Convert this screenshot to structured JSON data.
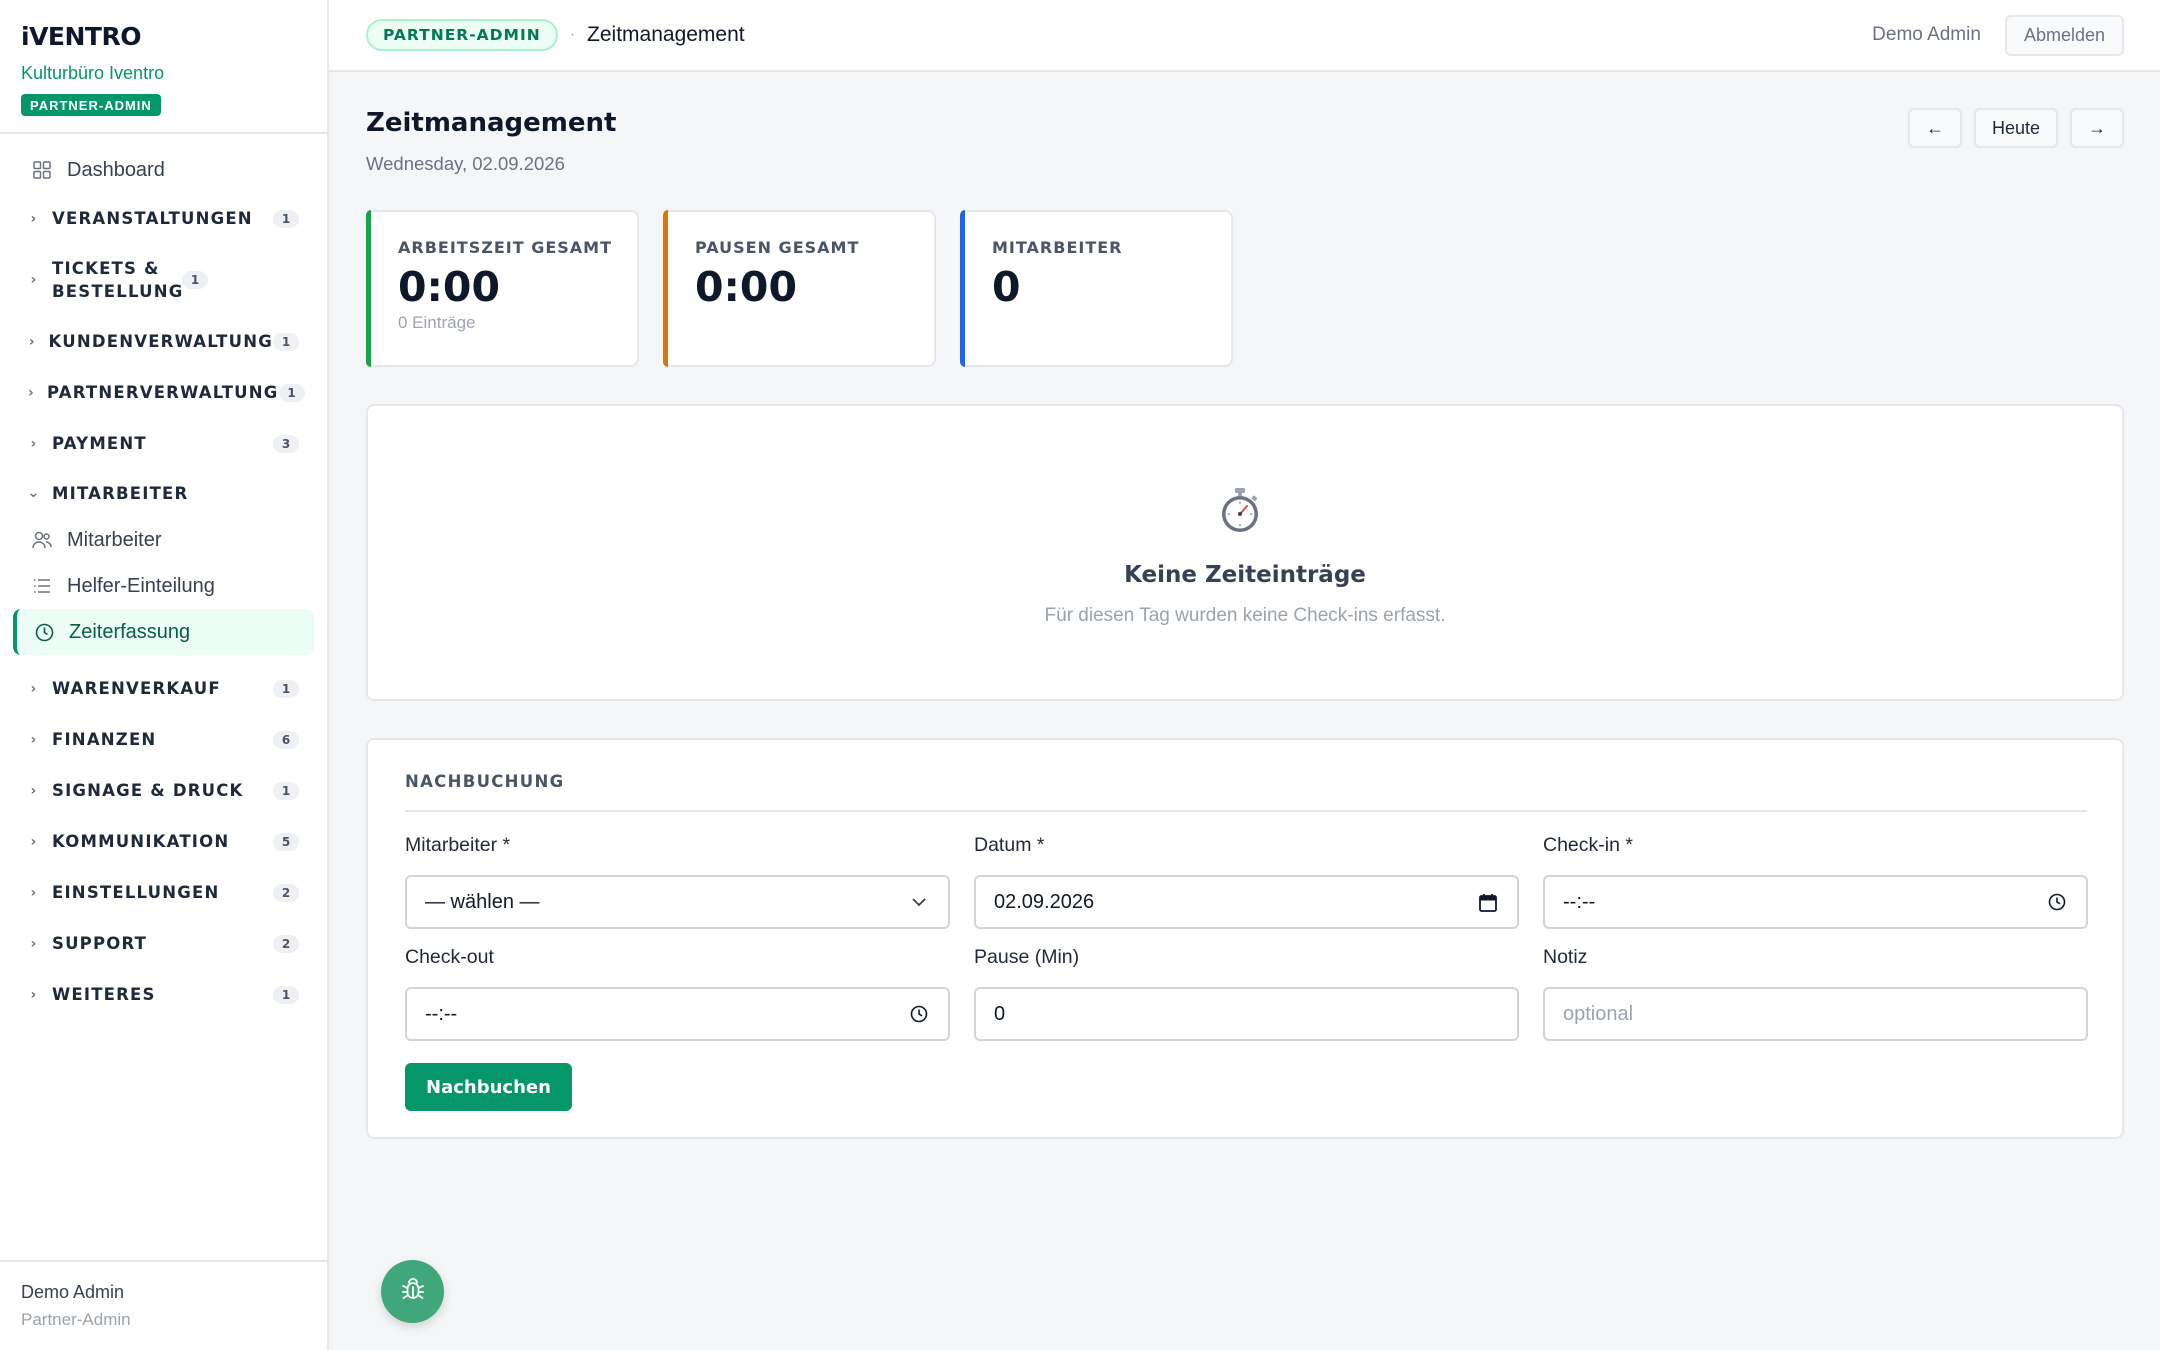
{
  "sidebar": {
    "logo": "iVENTRO",
    "org": "Kulturbüro Iventro",
    "role_badge": "PARTNER-ADMIN",
    "dashboard": {
      "label": "Dashboard",
      "icon": "grid-icon"
    },
    "groups": [
      {
        "label": "VERANSTALTUNGEN",
        "count": "1"
      },
      {
        "label": "TICKETS & BESTELLUNG",
        "count": "1"
      },
      {
        "label": "KUNDENVERWALTUNG",
        "count": "1"
      },
      {
        "label": "PARTNERVERWALTUNG",
        "count": "1"
      },
      {
        "label": "PAYMENT",
        "count": "3"
      }
    ],
    "open_group": {
      "label": "MITARBEITER",
      "items": [
        {
          "label": "Mitarbeiter",
          "icon": "users-icon"
        },
        {
          "label": "Helfer-Einteilung",
          "icon": "list-icon"
        },
        {
          "label": "Zeiterfassung",
          "icon": "clock-icon",
          "active": true
        }
      ]
    },
    "groups_after": [
      {
        "label": "WARENVERKAUF",
        "count": "1"
      },
      {
        "label": "FINANZEN",
        "count": "6"
      },
      {
        "label": "SIGNAGE & DRUCK",
        "count": "1"
      },
      {
        "label": "KOMMUNIKATION",
        "count": "5"
      },
      {
        "label": "EINSTELLUNGEN",
        "count": "2"
      },
      {
        "label": "SUPPORT",
        "count": "2"
      },
      {
        "label": "WEITERES",
        "count": "1"
      }
    ],
    "footer": {
      "name": "Demo Admin",
      "role": "Partner-Admin"
    }
  },
  "topbar": {
    "pill": "PARTNER-ADMIN",
    "separator": "·",
    "crumb": "Zeitmanagement",
    "user": "Demo Admin",
    "logout": "Abmelden"
  },
  "page": {
    "title": "Zeitmanagement",
    "date": "Wednesday, 02.09.2026",
    "prev": "←",
    "today": "Heute",
    "next": "→"
  },
  "stats": [
    {
      "label": "ARBEITSZEIT GESAMT",
      "value": "0:00",
      "sub": "0 Einträge",
      "accent": "#16a34a"
    },
    {
      "label": "PAUSEN GESAMT",
      "value": "0:00",
      "sub": "",
      "accent": "#d97706"
    },
    {
      "label": "MITARBEITER",
      "value": "0",
      "sub": "",
      "accent": "#2563eb"
    }
  ],
  "empty": {
    "icon": "stopwatch-icon",
    "title": "Keine Zeiteinträge",
    "desc": "Für diesen Tag wurden keine Check-ins erfasst."
  },
  "form": {
    "title": "NACHBUCHUNG",
    "employee": {
      "label": "Mitarbeiter *",
      "value": "— wählen —"
    },
    "date": {
      "label": "Datum *",
      "value": "02.09.2026"
    },
    "checkin": {
      "label": "Check-in *",
      "value": "--:--"
    },
    "checkout": {
      "label": "Check-out",
      "value": "--:--"
    },
    "pause": {
      "label": "Pause (Min)",
      "value": "0"
    },
    "note": {
      "label": "Notiz",
      "placeholder": "optional"
    },
    "submit": "Nachbuchen"
  },
  "fab": {
    "icon": "bug-icon"
  },
  "colors": {
    "accent": "#059669",
    "accent_light": "#ecfdf5"
  }
}
